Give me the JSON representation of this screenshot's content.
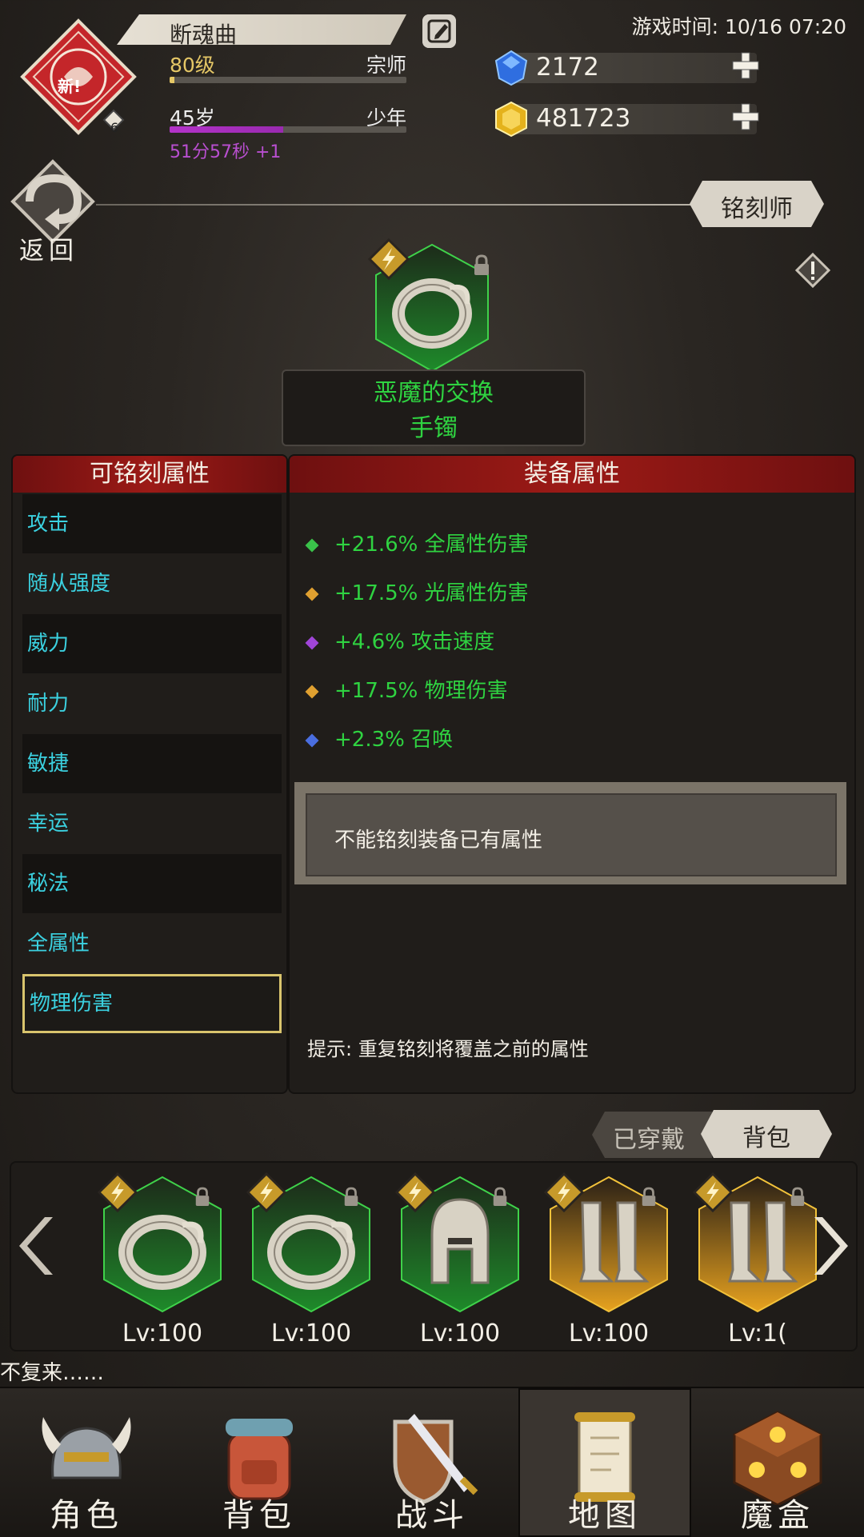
{
  "header": {
    "player_name": "断魂曲",
    "game_time": "游戏时间: 10/16 07:20",
    "level": "80级",
    "rank": "宗师",
    "level_progress": 0.02,
    "age": "45岁",
    "age_stage": "少年",
    "age_progress": 0.48,
    "timer": "51分57秒 +1",
    "emblem_badge": "新!",
    "emblem_count": "6",
    "blue_gems": "2172",
    "gold_gems": "481723"
  },
  "nav": {
    "back_label": "返回",
    "page_title": "铭刻师"
  },
  "item": {
    "name": "恶魔的交换",
    "type": "手镯"
  },
  "left_panel": {
    "title": "可铭刻属性",
    "attributes": [
      {
        "label": "攻击"
      },
      {
        "label": "随从强度"
      },
      {
        "label": "威力"
      },
      {
        "label": "耐力"
      },
      {
        "label": "敏捷"
      },
      {
        "label": "幸运"
      },
      {
        "label": "秘法"
      },
      {
        "label": "全属性"
      },
      {
        "label": "物理伤害"
      }
    ],
    "selected_index": 8
  },
  "right_panel": {
    "title": "装备属性",
    "stats": [
      {
        "text": "+21.6% 全属性伤害",
        "gem_color": "#3ac24a"
      },
      {
        "text": "+17.5% 光属性伤害",
        "gem_color": "#e0a030"
      },
      {
        "text": "+4.6% 攻击速度",
        "gem_color": "#a045d8"
      },
      {
        "text": "+17.5% 物理伤害",
        "gem_color": "#e0a030"
      },
      {
        "text": "+2.3% 召唤",
        "gem_color": "#4a6ee0"
      }
    ],
    "notice": "不能铭刻装备已有属性",
    "hint": "提示: 重复铭刻将覆盖之前的属性"
  },
  "tabs": {
    "worn": "已穿戴",
    "bag": "背包"
  },
  "inventory": [
    {
      "icon": "ring-icon",
      "level": "Lv:100",
      "rarity": "green"
    },
    {
      "icon": "ring-icon",
      "level": "Lv:100",
      "rarity": "green"
    },
    {
      "icon": "helmet-icon",
      "level": "Lv:100",
      "rarity": "green"
    },
    {
      "icon": "greaves-icon",
      "level": "Lv:100",
      "rarity": "gold"
    },
    {
      "icon": "greaves-icon",
      "level": "Lv:1(",
      "rarity": "gold"
    }
  ],
  "marquee": "不复来……",
  "bottom_nav": [
    {
      "label": "角色",
      "icon": "helmet-icon"
    },
    {
      "label": "背包",
      "icon": "backpack-icon"
    },
    {
      "label": "战斗",
      "icon": "sword-shield-icon"
    },
    {
      "label": "地图",
      "icon": "scroll-map-icon"
    },
    {
      "label": "魔盒",
      "icon": "magic-box-icon"
    }
  ],
  "colors": {
    "green_text": "#2fd341",
    "cyan_text": "#3bd1e0",
    "red_header": "#9c1a16",
    "gold_accent": "#e5c766"
  }
}
